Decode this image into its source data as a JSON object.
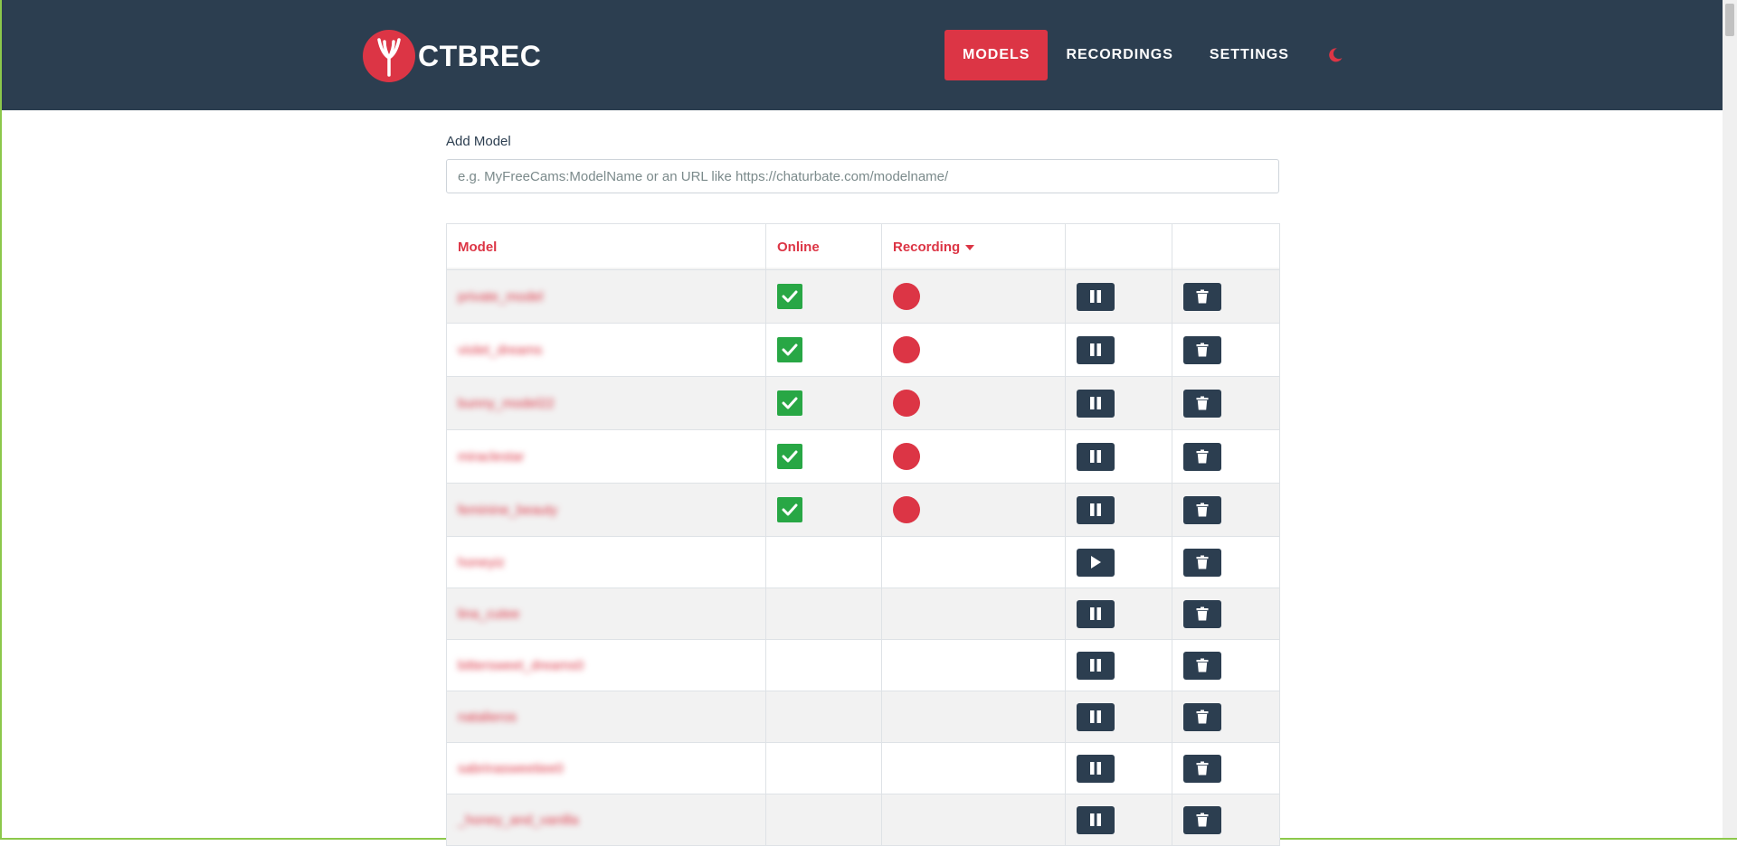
{
  "app": {
    "brand": "CTBREC"
  },
  "nav": {
    "models": "Models",
    "recordings": "Recordings",
    "settings": "Settings",
    "theme_icon": "moon-icon"
  },
  "add_model": {
    "label": "Add Model",
    "placeholder": "e.g. MyFreeCams:ModelName or an URL like https://chaturbate.com/modelname/"
  },
  "table": {
    "columns": {
      "model": "Model",
      "online": "Online",
      "recording": "Recording"
    },
    "rows": [
      {
        "name": "private_model",
        "online": true,
        "recording": true,
        "action": "pause"
      },
      {
        "name": "violet_dreams",
        "online": true,
        "recording": true,
        "action": "pause"
      },
      {
        "name": "bunny_model22",
        "online": true,
        "recording": true,
        "action": "pause"
      },
      {
        "name": "miraclestar",
        "online": true,
        "recording": true,
        "action": "pause"
      },
      {
        "name": "feminine_beauty",
        "online": true,
        "recording": true,
        "action": "pause"
      },
      {
        "name": "honeyiz",
        "online": false,
        "recording": false,
        "action": "play"
      },
      {
        "name": "lina_cutee",
        "online": false,
        "recording": false,
        "action": "pause"
      },
      {
        "name": "bittersweet_dreams0",
        "online": false,
        "recording": false,
        "action": "pause"
      },
      {
        "name": "natalieros",
        "online": false,
        "recording": false,
        "action": "pause"
      },
      {
        "name": "sabrinasweetiee0",
        "online": false,
        "recording": false,
        "action": "pause"
      },
      {
        "name": "_honey_and_vanilla",
        "online": false,
        "recording": false,
        "action": "pause"
      }
    ]
  },
  "colors": {
    "navbar": "#2c3e50",
    "accent": "#dc3545",
    "online": "#28a745",
    "button": "#2c3e50"
  }
}
